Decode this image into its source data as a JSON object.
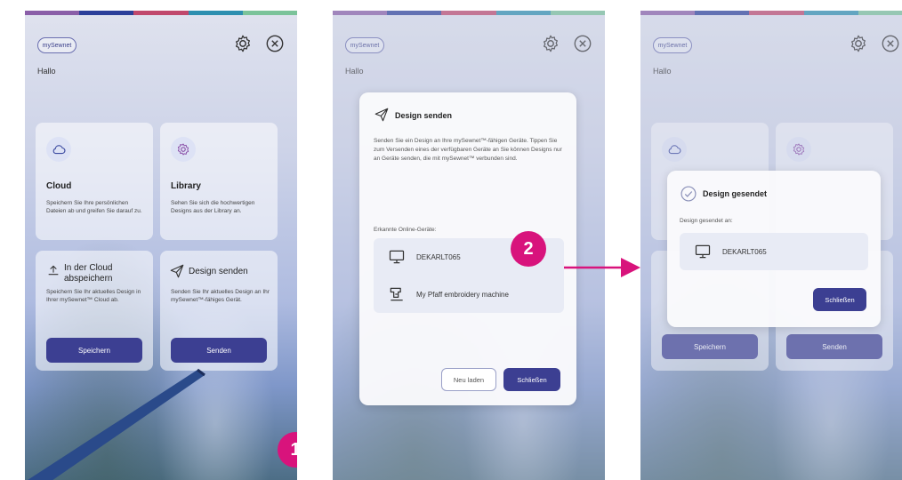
{
  "colors": {
    "accent": "#3c3f92",
    "badge": "#d8137c",
    "strip": [
      "#8a5ea8",
      "#2b3f9a",
      "#c0486c",
      "#2d8fb0",
      "#7bc39a"
    ]
  },
  "screen1": {
    "logo": "mySewnet",
    "greeting": "Hallo",
    "cards": {
      "cloud": {
        "title": "Cloud",
        "desc": "Speichern Sie Ihre persönlichen Dateien ab und greifen Sie darauf zu."
      },
      "library": {
        "title": "Library",
        "desc": "Sehen Sie sich die hochwertigen Designs aus der Library an."
      },
      "save": {
        "title": "In der Cloud abspeichern",
        "desc": "Speichern Sie Ihr aktuelles Design in Ihrer mySewnet™ Cloud ab."
      },
      "send": {
        "title": "Design senden",
        "desc": "Senden Sie Ihr aktuelles Design an Ihr mySewnet™-fähiges Gerät."
      }
    },
    "buttons": {
      "save": "Speichern",
      "send": "Senden"
    },
    "badge": "1"
  },
  "screen2": {
    "logo": "mySewnet",
    "greeting": "Hallo",
    "dialog": {
      "title": "Design senden",
      "text": "Senden Sie ein Design an Ihre mySewnet™-fähigen Geräte. Tippen Sie zum Versenden eines der verfügbaren Geräte an Sie können Designs nur an Geräte senden, die mit mySewnet™ verbunden sind.",
      "devices_label": "Erkannte Online-Geräte:",
      "devices": [
        "DEKARLT065",
        "My Pfaff embroidery machine"
      ],
      "reload": "Neu laden",
      "close": "Schließen"
    },
    "badge": "2"
  },
  "screen3": {
    "logo": "mySewnet",
    "greeting": "Hallo",
    "dialog": {
      "title": "Design gesendet",
      "sent_to": "Design gesendet an:",
      "device": "DEKARLT065",
      "close": "Schließen"
    },
    "buttons": {
      "save": "Speichern",
      "send": "Senden"
    }
  }
}
